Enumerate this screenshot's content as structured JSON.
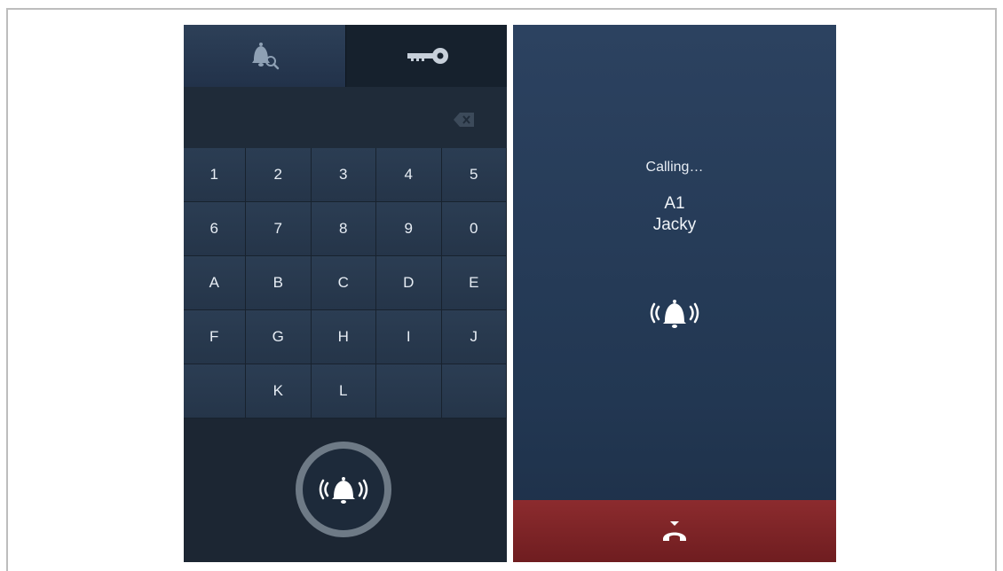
{
  "keypad_panel": {
    "tabs": [
      {
        "name": "search-resident",
        "icon": "bell-search-icon",
        "selected": true
      },
      {
        "name": "unlock",
        "icon": "key-icon",
        "selected": false
      }
    ],
    "display_value": "",
    "backspace_icon": "backspace-icon",
    "keys": [
      "1",
      "2",
      "3",
      "4",
      "5",
      "6",
      "7",
      "8",
      "9",
      "0",
      "A",
      "B",
      "C",
      "D",
      "E",
      "F",
      "G",
      "H",
      "I",
      "J",
      "",
      "K",
      "L",
      "",
      ""
    ],
    "call_button_icon": "ringing-bell-icon"
  },
  "calling_panel": {
    "status": "Calling…",
    "caller_id": "A1",
    "caller_name": "Jacky",
    "ringing_icon": "ringing-bell-icon",
    "hangup_icon": "hang-up-icon"
  },
  "colors": {
    "panel_dark": "#1c2836",
    "key_bg": "#2b3d53",
    "hangup_red": "#8c2b2e",
    "ring_gray": "#6e7a86"
  }
}
